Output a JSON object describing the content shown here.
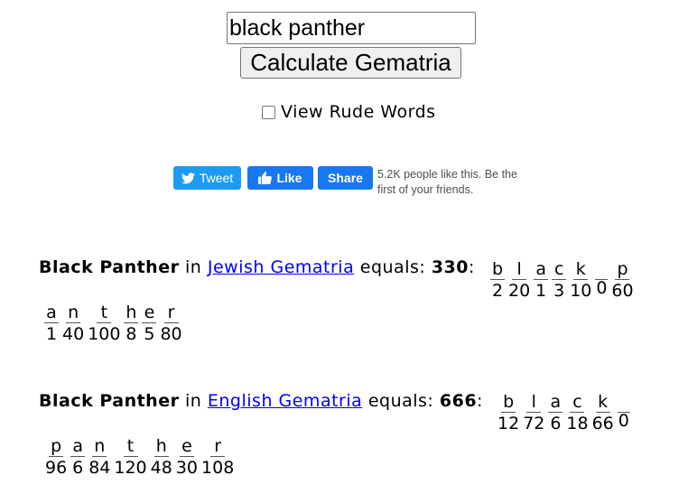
{
  "search": {
    "value": "black panther"
  },
  "calculate_button": "Calculate Gematria",
  "rude_words_label": "View Rude Words",
  "social": {
    "tweet_label": "Tweet",
    "like_label": "Like",
    "share_label": "Share",
    "fb_text": "5.2K people like this. Be the first of your friends.",
    "tweet_color": "#1d9bf0",
    "facebook_color": "#1877f2"
  },
  "results": [
    {
      "phrase": "Black Panther",
      "in_text": " in ",
      "cipher": "Jewish Gematria",
      "equals_text": " equals: ",
      "total": "330",
      "colon": ":",
      "row1": [
        {
          "l": "b",
          "v": "2"
        },
        {
          "l": "l",
          "v": "20"
        },
        {
          "l": "a",
          "v": "1"
        },
        {
          "l": "c",
          "v": "3"
        },
        {
          "l": "k",
          "v": "10"
        },
        {
          "l": "",
          "v": "0"
        },
        {
          "l": "p",
          "v": "60"
        }
      ],
      "row2": [
        {
          "l": "a",
          "v": "1"
        },
        {
          "l": "n",
          "v": "40"
        },
        {
          "l": "t",
          "v": "100"
        },
        {
          "l": "h",
          "v": "8"
        },
        {
          "l": "e",
          "v": "5"
        },
        {
          "l": "r",
          "v": "80"
        }
      ]
    },
    {
      "phrase": "Black Panther",
      "in_text": " in ",
      "cipher": "English Gematria",
      "equals_text": " equals: ",
      "total": "666",
      "colon": ":",
      "row1": [
        {
          "l": "b",
          "v": "12"
        },
        {
          "l": "l",
          "v": "72"
        },
        {
          "l": "a",
          "v": "6"
        },
        {
          "l": "c",
          "v": "18"
        },
        {
          "l": "k",
          "v": "66"
        },
        {
          "l": "",
          "v": "0"
        }
      ],
      "row2": [
        {
          "l": "p",
          "v": "96"
        },
        {
          "l": "a",
          "v": "6"
        },
        {
          "l": "n",
          "v": "84"
        },
        {
          "l": "t",
          "v": "120"
        },
        {
          "l": "h",
          "v": "48"
        },
        {
          "l": "e",
          "v": "30"
        },
        {
          "l": "r",
          "v": "108"
        }
      ]
    }
  ]
}
